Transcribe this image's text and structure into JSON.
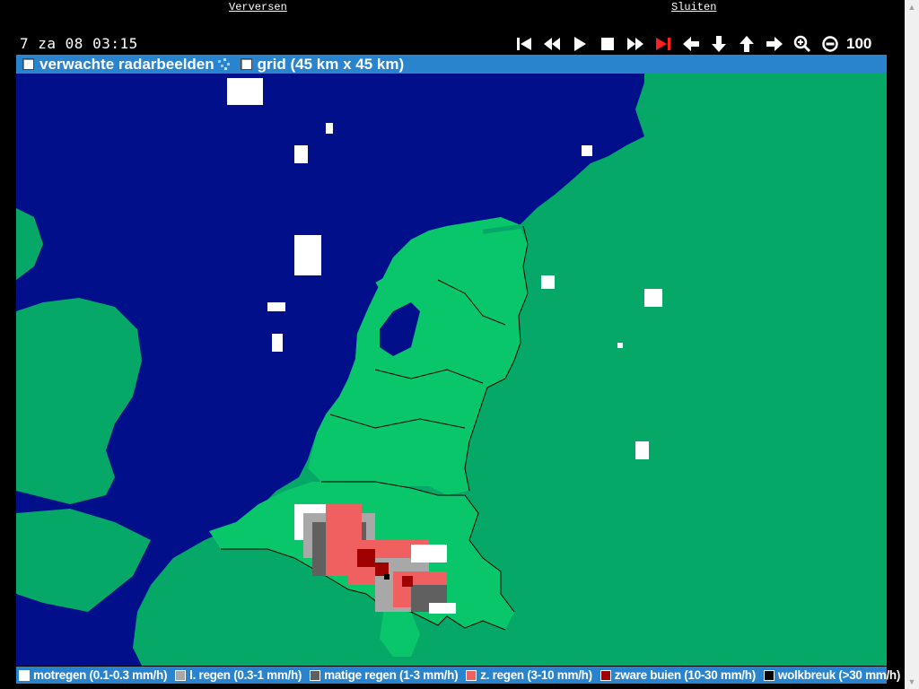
{
  "top_links": {
    "refresh": "Verversen",
    "close": "Sluiten"
  },
  "timestamp": "7 za 08 03:15",
  "controls": {
    "icons": [
      "first-frame-icon",
      "rewind-icon",
      "play-icon",
      "stop-icon",
      "fast-forward-icon",
      "last-frame-icon",
      "pan-left-icon",
      "pan-down-icon",
      "pan-up-icon",
      "pan-right-icon",
      "zoom-in-icon",
      "zoom-out-icon"
    ],
    "zoom_level": "100",
    "active_color": "#ff2020"
  },
  "options": {
    "forecast_label": "verwachte radarbeelden",
    "grid_label": "grid (45 km x 45 km)"
  },
  "legend": [
    {
      "label": "motregen (0.1-0.3 mm/h)",
      "color": "#ffffff"
    },
    {
      "label": "l. regen (0.3-1 mm/h)",
      "color": "#a8a8a8"
    },
    {
      "label": "matige regen (1-3 mm/h)",
      "color": "#606060"
    },
    {
      "label": "z. regen (3-10 mm/h)",
      "color": "#f06060"
    },
    {
      "label": "zware buien (10-30 mm/h)",
      "color": "#a00000"
    },
    {
      "label": "wolkbreuk (>30 mm/h)",
      "color": "#000000"
    }
  ],
  "colors": {
    "sea": "#020f8a",
    "land": "#05a866",
    "highlight_land": "#09c66a",
    "bar": "#2a83cd"
  }
}
